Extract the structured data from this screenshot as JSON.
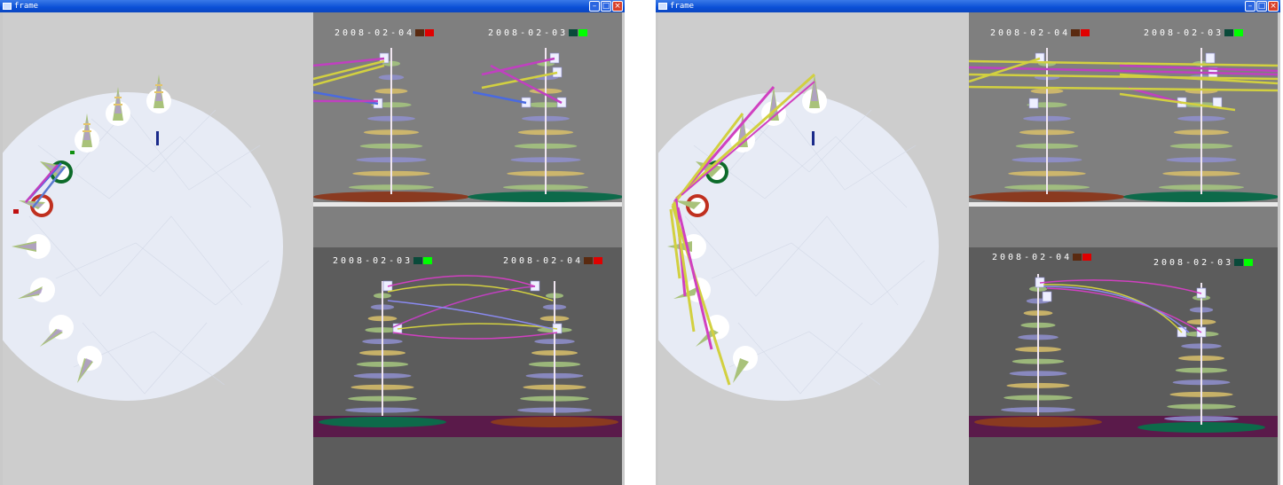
{
  "windows": [
    {
      "title": "frame",
      "controls": {
        "minimize": "–",
        "maximize": "□",
        "close": "×"
      },
      "panels": [
        {
          "labels": [
            {
              "text": "2008-02-04",
              "swatches": [
                "#5a2a10",
                "#e00000"
              ]
            },
            {
              "text": "2008-02-03",
              "swatches": [
                "#0a4a3a",
                "#00ff00"
              ]
            }
          ]
        },
        {
          "labels": [
            {
              "text": "2008-02-03",
              "swatches": [
                "#0a4a3a",
                "#00ff00"
              ]
            },
            {
              "text": "2008-02-04",
              "swatches": [
                "#5a2a10",
                "#e00000"
              ]
            }
          ]
        }
      ]
    },
    {
      "title": "frame",
      "controls": {
        "minimize": "–",
        "maximize": "□",
        "close": "×"
      },
      "panels": [
        {
          "labels": [
            {
              "text": "2008-02-04",
              "swatches": [
                "#5a2a10",
                "#e00000"
              ]
            },
            {
              "text": "2008-02-03",
              "swatches": [
                "#0a4a3a",
                "#00ff00"
              ]
            }
          ]
        },
        {
          "labels": [
            {
              "text": "2008-02-04",
              "swatches": [
                "#5a2a10",
                "#e00000"
              ]
            },
            {
              "text": "2008-02-03",
              "swatches": [
                "#0a4a3a",
                "#00ff00"
              ]
            }
          ]
        }
      ]
    }
  ]
}
